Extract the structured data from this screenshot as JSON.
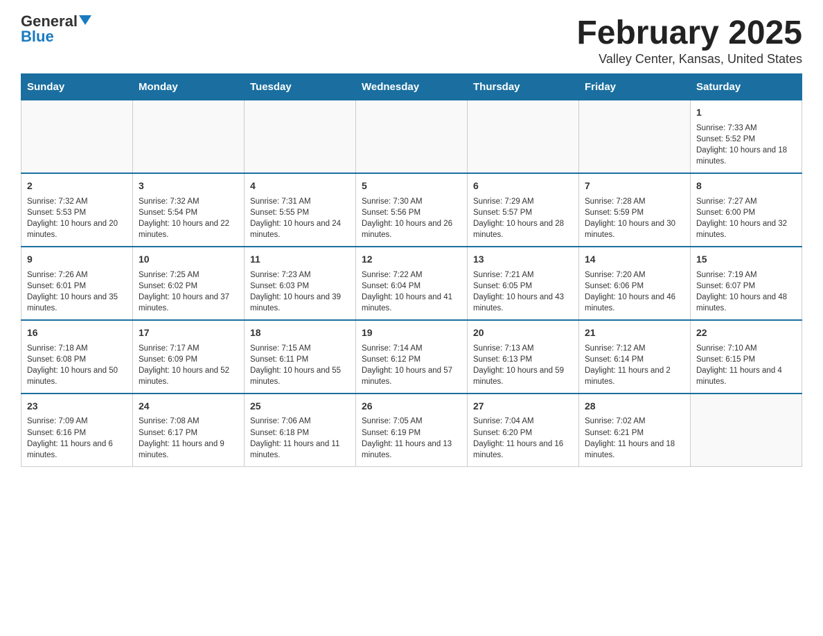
{
  "header": {
    "logo_general": "General",
    "logo_blue": "Blue",
    "main_title": "February 2025",
    "subtitle": "Valley Center, Kansas, United States"
  },
  "days_of_week": [
    "Sunday",
    "Monday",
    "Tuesday",
    "Wednesday",
    "Thursday",
    "Friday",
    "Saturday"
  ],
  "weeks": [
    {
      "days": [
        {
          "number": "",
          "info": ""
        },
        {
          "number": "",
          "info": ""
        },
        {
          "number": "",
          "info": ""
        },
        {
          "number": "",
          "info": ""
        },
        {
          "number": "",
          "info": ""
        },
        {
          "number": "",
          "info": ""
        },
        {
          "number": "1",
          "info": "Sunrise: 7:33 AM\nSunset: 5:52 PM\nDaylight: 10 hours and 18 minutes."
        }
      ]
    },
    {
      "days": [
        {
          "number": "2",
          "info": "Sunrise: 7:32 AM\nSunset: 5:53 PM\nDaylight: 10 hours and 20 minutes."
        },
        {
          "number": "3",
          "info": "Sunrise: 7:32 AM\nSunset: 5:54 PM\nDaylight: 10 hours and 22 minutes."
        },
        {
          "number": "4",
          "info": "Sunrise: 7:31 AM\nSunset: 5:55 PM\nDaylight: 10 hours and 24 minutes."
        },
        {
          "number": "5",
          "info": "Sunrise: 7:30 AM\nSunset: 5:56 PM\nDaylight: 10 hours and 26 minutes."
        },
        {
          "number": "6",
          "info": "Sunrise: 7:29 AM\nSunset: 5:57 PM\nDaylight: 10 hours and 28 minutes."
        },
        {
          "number": "7",
          "info": "Sunrise: 7:28 AM\nSunset: 5:59 PM\nDaylight: 10 hours and 30 minutes."
        },
        {
          "number": "8",
          "info": "Sunrise: 7:27 AM\nSunset: 6:00 PM\nDaylight: 10 hours and 32 minutes."
        }
      ]
    },
    {
      "days": [
        {
          "number": "9",
          "info": "Sunrise: 7:26 AM\nSunset: 6:01 PM\nDaylight: 10 hours and 35 minutes."
        },
        {
          "number": "10",
          "info": "Sunrise: 7:25 AM\nSunset: 6:02 PM\nDaylight: 10 hours and 37 minutes."
        },
        {
          "number": "11",
          "info": "Sunrise: 7:23 AM\nSunset: 6:03 PM\nDaylight: 10 hours and 39 minutes."
        },
        {
          "number": "12",
          "info": "Sunrise: 7:22 AM\nSunset: 6:04 PM\nDaylight: 10 hours and 41 minutes."
        },
        {
          "number": "13",
          "info": "Sunrise: 7:21 AM\nSunset: 6:05 PM\nDaylight: 10 hours and 43 minutes."
        },
        {
          "number": "14",
          "info": "Sunrise: 7:20 AM\nSunset: 6:06 PM\nDaylight: 10 hours and 46 minutes."
        },
        {
          "number": "15",
          "info": "Sunrise: 7:19 AM\nSunset: 6:07 PM\nDaylight: 10 hours and 48 minutes."
        }
      ]
    },
    {
      "days": [
        {
          "number": "16",
          "info": "Sunrise: 7:18 AM\nSunset: 6:08 PM\nDaylight: 10 hours and 50 minutes."
        },
        {
          "number": "17",
          "info": "Sunrise: 7:17 AM\nSunset: 6:09 PM\nDaylight: 10 hours and 52 minutes."
        },
        {
          "number": "18",
          "info": "Sunrise: 7:15 AM\nSunset: 6:11 PM\nDaylight: 10 hours and 55 minutes."
        },
        {
          "number": "19",
          "info": "Sunrise: 7:14 AM\nSunset: 6:12 PM\nDaylight: 10 hours and 57 minutes."
        },
        {
          "number": "20",
          "info": "Sunrise: 7:13 AM\nSunset: 6:13 PM\nDaylight: 10 hours and 59 minutes."
        },
        {
          "number": "21",
          "info": "Sunrise: 7:12 AM\nSunset: 6:14 PM\nDaylight: 11 hours and 2 minutes."
        },
        {
          "number": "22",
          "info": "Sunrise: 7:10 AM\nSunset: 6:15 PM\nDaylight: 11 hours and 4 minutes."
        }
      ]
    },
    {
      "days": [
        {
          "number": "23",
          "info": "Sunrise: 7:09 AM\nSunset: 6:16 PM\nDaylight: 11 hours and 6 minutes."
        },
        {
          "number": "24",
          "info": "Sunrise: 7:08 AM\nSunset: 6:17 PM\nDaylight: 11 hours and 9 minutes."
        },
        {
          "number": "25",
          "info": "Sunrise: 7:06 AM\nSunset: 6:18 PM\nDaylight: 11 hours and 11 minutes."
        },
        {
          "number": "26",
          "info": "Sunrise: 7:05 AM\nSunset: 6:19 PM\nDaylight: 11 hours and 13 minutes."
        },
        {
          "number": "27",
          "info": "Sunrise: 7:04 AM\nSunset: 6:20 PM\nDaylight: 11 hours and 16 minutes."
        },
        {
          "number": "28",
          "info": "Sunrise: 7:02 AM\nSunset: 6:21 PM\nDaylight: 11 hours and 18 minutes."
        },
        {
          "number": "",
          "info": ""
        }
      ]
    }
  ]
}
